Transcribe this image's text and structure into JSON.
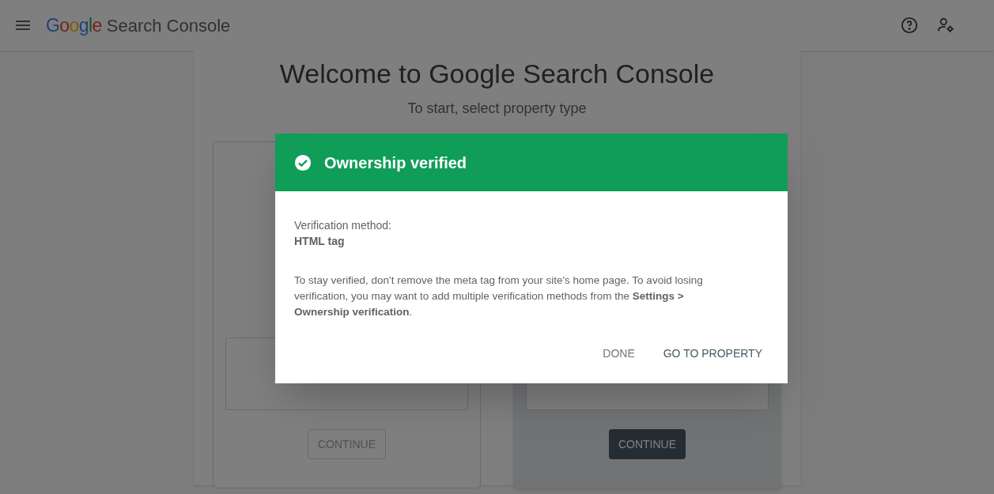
{
  "app_bar": {
    "logo": "Google",
    "product": "Search Console"
  },
  "welcome": {
    "title": "Welcome to Google Search Console",
    "subtitle": "To start, select property type"
  },
  "property_types": [
    {
      "selected": false,
      "continue": {
        "label": "CONTINUE",
        "disabled": true
      }
    },
    {
      "selected": true,
      "continue": {
        "label": "CONTINUE",
        "disabled": false
      }
    }
  ],
  "dialog": {
    "title": "Ownership verified",
    "method_label": "Verification method:",
    "method": "HTML tag",
    "message": "To stay verified, don't remove the meta tag from your site's home page. To avoid losing verification, you may want to add multiple verification methods from the **Settings > Ownership verification**.",
    "buttons": [
      {
        "label": "DONE",
        "kind": "secondary"
      },
      {
        "label": "GO TO PROPERTY",
        "kind": "primary"
      }
    ]
  }
}
